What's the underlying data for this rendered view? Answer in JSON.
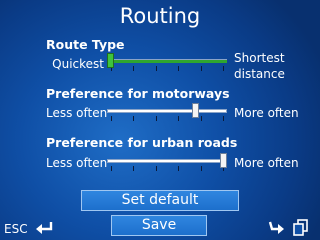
{
  "window": {
    "title": "Routing"
  },
  "sections": [
    {
      "heading": "Route Type",
      "left_label": "Quickest",
      "right_label_line1": "Shortest",
      "right_label_line2": "distance",
      "level": 0.0,
      "fill_color": "#2fa62f"
    },
    {
      "heading": "Preference for motorways",
      "left_label": "Less often",
      "right_label": "More often",
      "level": 0.75
    },
    {
      "heading": "Preference for urban roads",
      "left_label": "Less often",
      "right_label": "More often",
      "level": 1.0
    }
  ],
  "buttons": {
    "set_default": "Set default",
    "save": "Save"
  },
  "footer": {
    "esc_label": "ESC"
  },
  "icons": {
    "esc_arrow": "back-arrow-icon",
    "next_arrow": "forward-arrow-icon",
    "pages": "copy-pages-icon"
  },
  "colors": {
    "background": "#0f4fa6",
    "accent_green": "#3ec43e",
    "button": "#1d6fcc"
  }
}
